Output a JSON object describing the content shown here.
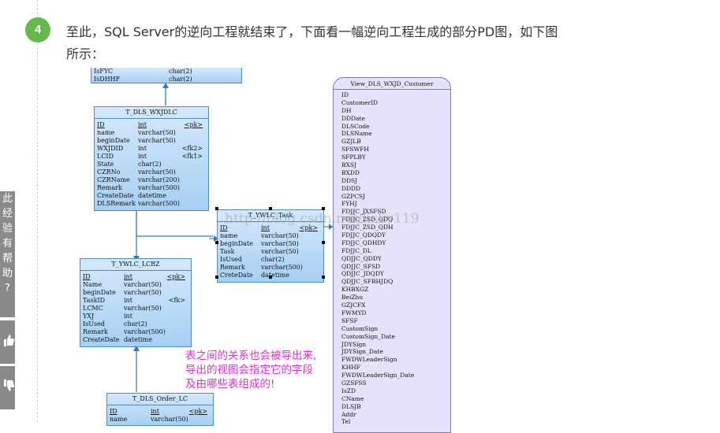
{
  "step": {
    "number": "4"
  },
  "paragraph": {
    "line1": "至此，SQL Server的逆向工程就结束了，下面看一幅逆向工程生成的部分PD图，如下图",
    "line2": "所示："
  },
  "side": {
    "tab_text": [
      "此",
      "经",
      "验",
      "有",
      "帮",
      "助",
      "?"
    ]
  },
  "diagram": {
    "top_table": {
      "rows": [
        [
          "IsFYC",
          "char(2)",
          ""
        ],
        [
          "IsDHHF",
          "char(2)",
          ""
        ]
      ]
    },
    "t_wxjdlc": {
      "title": "T_DLS_WXJDLC",
      "rows": [
        [
          "ID",
          "int",
          "<pk>"
        ],
        [
          "name",
          "varchar(50)",
          ""
        ],
        [
          "beginDate",
          "varchar(50)",
          ""
        ],
        [
          "WXJDID",
          "int",
          "<fk2>"
        ],
        [
          "LCID",
          "int",
          "<fk1>"
        ],
        [
          "State",
          "char(2)",
          ""
        ],
        [
          "CZRNo",
          "varchar(50)",
          ""
        ],
        [
          "CZRName",
          "varchar(200)",
          ""
        ],
        [
          "Remark",
          "varchar(500)",
          ""
        ],
        [
          "CreateDate",
          "datetime",
          ""
        ],
        [
          "DLSRemark",
          "varchar(500)",
          ""
        ]
      ]
    },
    "t_ywlc_task": {
      "title": "T_YWLC_Task",
      "rows": [
        [
          "ID",
          "int",
          "<pk>"
        ],
        [
          "name",
          "varchar(50)",
          ""
        ],
        [
          "beginDate",
          "varchar(50)",
          ""
        ],
        [
          "Task",
          "varchar(50)",
          ""
        ],
        [
          "IsUsed",
          "char(2)",
          ""
        ],
        [
          "Remark",
          "varchar(500)",
          ""
        ],
        [
          "CreteDate",
          "datetime",
          ""
        ]
      ]
    },
    "t_ywlc_lcbz": {
      "title": "T_YWLC_LCBZ",
      "rows": [
        [
          "ID",
          "int",
          "<pk>"
        ],
        [
          "Name",
          "varchar(50)",
          ""
        ],
        [
          "beginDate",
          "varchar(50)",
          ""
        ],
        [
          "TaskID",
          "int",
          "<fk>"
        ],
        [
          "LCMC",
          "varchar(50)",
          ""
        ],
        [
          "YXJ",
          "int",
          ""
        ],
        [
          "IsUsed",
          "char(2)",
          ""
        ],
        [
          "Remark",
          "varchar(500)",
          ""
        ],
        [
          "CreateDate",
          "datetime",
          ""
        ]
      ]
    },
    "t_order_lc": {
      "title": "T_DLS_Order_LC",
      "rows": [
        [
          "ID",
          "int",
          "<pk>"
        ],
        [
          "name",
          "varchar(50)",
          ""
        ]
      ]
    },
    "view": {
      "title": "View_DLS_WXJD_Customer",
      "fields": [
        "ID",
        "CustomerID",
        "DH",
        "DDDate",
        "DLSCode",
        "DLSName",
        "GZJLB",
        "SFSWFH",
        "SFPLBY",
        "BXSJ",
        "BXDD",
        "DDSJ",
        "DDDD",
        "GZPCSJ",
        "FYHJ",
        "FDJJC_JXSFSD",
        "FDJJC_ZSD_QDQ",
        "FDJJC_ZSD_QDH",
        "FDJJC_QDQDY",
        "FDJJC_QDHDY",
        "FDJJC_DL",
        "QDJJC_QDDY",
        "QDJJC_SFSD",
        "QDJJC_JDQDY",
        "QDJJC_SFBHJDQ",
        "KHBXGZ",
        "BeiZhu",
        "GZJCFX",
        "FWMYD",
        "SFSF",
        "CustomSign",
        "CustomSign_Date",
        "JDYSign",
        "JDYSign_Date",
        "FWDWLeaderSign",
        "KHHF",
        "FWDWLeaderSign_Date",
        "GZSFSS",
        "IsZD",
        "CName",
        "DLSJB",
        "Addr",
        "Tel"
      ]
    },
    "annotation": [
      "表之间的关系也会被导出来,",
      "导出的视图会指定它的字段",
      " 及由哪些表组成的!"
    ],
    "watermark": "http://blog.csdn.net/lisky119"
  }
}
